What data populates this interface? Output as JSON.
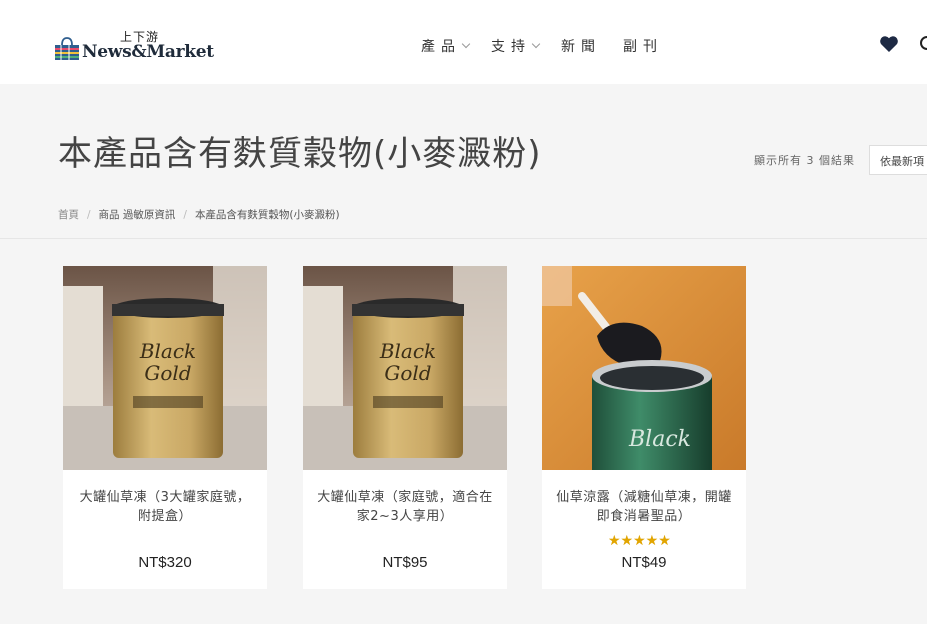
{
  "header": {
    "logo_top": "上下游",
    "logo_main": "News&Market",
    "nav": [
      {
        "label": "產品",
        "has_dropdown": true
      },
      {
        "label": "支持",
        "has_dropdown": true
      },
      {
        "label": "新聞",
        "has_dropdown": false
      },
      {
        "label": "副刊",
        "has_dropdown": false
      }
    ],
    "icons": [
      "heart-icon",
      "search-icon"
    ]
  },
  "page": {
    "title": "本產品含有麩質穀物(小麥澱粉)",
    "result_count": "顯示所有 3 個結果",
    "sort_value": "依最新項"
  },
  "breadcrumb": [
    "首頁",
    "商品 過敏原資訊",
    "本產品含有麩質穀物(小麥澱粉)"
  ],
  "products": [
    {
      "name": "大罐仙草凍（3大罐家庭號，附提盒）",
      "price": "NT$320",
      "rating": null
    },
    {
      "name": "大罐仙草凍（家庭號，適合在家2~3人享用）",
      "price": "NT$95",
      "rating": null
    },
    {
      "name": "仙草涼露（減糖仙草凍，開罐即食消暑聖品）",
      "price": "NT$49",
      "rating": 4.5
    }
  ],
  "colors": {
    "header_bg": "#ffffff",
    "page_bg": "#f5f5f5",
    "star": "#e2a500"
  }
}
